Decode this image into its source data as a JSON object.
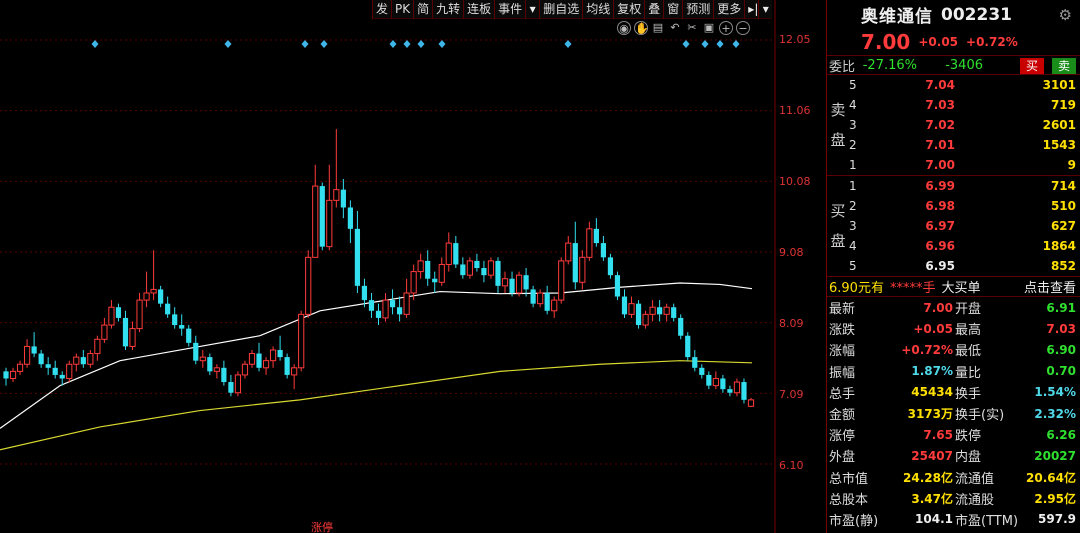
{
  "toolbar": {
    "items": [
      "发",
      "PK",
      "简",
      "九转",
      "连板",
      "事件",
      "▾",
      "删自选",
      "均线",
      "复权",
      "叠",
      "窗",
      "预测",
      "更多",
      "▸|",
      "▾"
    ]
  },
  "chart_icons": [
    "eye-icon",
    "hand-icon",
    "text-icon",
    "undo-icon",
    "scissors-icon",
    "lock-icon",
    "zoom-in-icon",
    "zoom-out-icon"
  ],
  "price_axis": [
    "12.05",
    "11.06",
    "10.08",
    "9.08",
    "8.09",
    "7.09",
    "6.10"
  ],
  "chart_data": {
    "type": "candlestick",
    "title": "",
    "ylim": [
      6.1,
      12.05
    ],
    "colors": {
      "up": "#ff3b3b",
      "down": "#33e0f0",
      "ma_long": "#ffffff",
      "ma_longer": "#d8d830"
    },
    "candles": [
      [
        7.4,
        7.45,
        7.2,
        7.3
      ],
      [
        7.3,
        7.45,
        7.25,
        7.4
      ],
      [
        7.4,
        7.55,
        7.35,
        7.5
      ],
      [
        7.5,
        7.85,
        7.45,
        7.75
      ],
      [
        7.75,
        7.95,
        7.6,
        7.65
      ],
      [
        7.65,
        7.7,
        7.45,
        7.5
      ],
      [
        7.5,
        7.6,
        7.35,
        7.45
      ],
      [
        7.45,
        7.55,
        7.3,
        7.35
      ],
      [
        7.35,
        7.4,
        7.2,
        7.3
      ],
      [
        7.3,
        7.55,
        7.25,
        7.5
      ],
      [
        7.5,
        7.65,
        7.4,
        7.6
      ],
      [
        7.6,
        7.7,
        7.45,
        7.5
      ],
      [
        7.5,
        7.7,
        7.45,
        7.65
      ],
      [
        7.65,
        7.9,
        7.55,
        7.85
      ],
      [
        7.85,
        8.15,
        7.8,
        8.05
      ],
      [
        8.05,
        8.4,
        8.0,
        8.3
      ],
      [
        8.3,
        8.35,
        8.1,
        8.15
      ],
      [
        8.15,
        8.25,
        7.7,
        7.75
      ],
      [
        7.75,
        8.1,
        7.7,
        8.0
      ],
      [
        8.0,
        8.5,
        7.95,
        8.4
      ],
      [
        8.4,
        8.8,
        8.3,
        8.5
      ],
      [
        8.5,
        9.1,
        8.4,
        8.55
      ],
      [
        8.55,
        8.6,
        8.3,
        8.35
      ],
      [
        8.35,
        8.45,
        8.15,
        8.2
      ],
      [
        8.2,
        8.3,
        8.0,
        8.05
      ],
      [
        8.05,
        8.2,
        7.9,
        8.0
      ],
      [
        8.0,
        8.05,
        7.75,
        7.8
      ],
      [
        7.8,
        7.9,
        7.5,
        7.55
      ],
      [
        7.55,
        7.7,
        7.45,
        7.6
      ],
      [
        7.6,
        7.65,
        7.35,
        7.4
      ],
      [
        7.4,
        7.5,
        7.3,
        7.45
      ],
      [
        7.45,
        7.55,
        7.2,
        7.25
      ],
      [
        7.25,
        7.35,
        7.05,
        7.1
      ],
      [
        7.1,
        7.4,
        7.05,
        7.35
      ],
      [
        7.35,
        7.55,
        7.3,
        7.5
      ],
      [
        7.5,
        7.7,
        7.45,
        7.65
      ],
      [
        7.65,
        7.8,
        7.4,
        7.45
      ],
      [
        7.45,
        7.6,
        7.35,
        7.55
      ],
      [
        7.55,
        7.75,
        7.45,
        7.7
      ],
      [
        7.7,
        7.9,
        7.55,
        7.6
      ],
      [
        7.6,
        7.65,
        7.3,
        7.35
      ],
      [
        7.35,
        7.5,
        7.15,
        7.45
      ],
      [
        7.45,
        8.25,
        7.4,
        8.2
      ],
      [
        8.2,
        9.1,
        8.15,
        9.0
      ],
      [
        9.0,
        10.3,
        9.0,
        10.0
      ],
      [
        10.0,
        10.05,
        9.1,
        9.15
      ],
      [
        9.15,
        10.3,
        9.1,
        9.8
      ],
      [
        9.8,
        10.8,
        9.7,
        9.95
      ],
      [
        9.95,
        10.1,
        9.55,
        9.7
      ],
      [
        9.7,
        9.8,
        9.2,
        9.4
      ],
      [
        9.4,
        9.65,
        8.5,
        8.6
      ],
      [
        8.6,
        8.7,
        8.3,
        8.4
      ],
      [
        8.4,
        8.5,
        8.15,
        8.25
      ],
      [
        8.25,
        8.35,
        8.05,
        8.15
      ],
      [
        8.15,
        8.5,
        8.1,
        8.4
      ],
      [
        8.4,
        8.55,
        8.2,
        8.3
      ],
      [
        8.3,
        8.45,
        8.1,
        8.2
      ],
      [
        8.2,
        8.7,
        8.15,
        8.5
      ],
      [
        8.5,
        8.9,
        8.4,
        8.8
      ],
      [
        8.8,
        9.05,
        8.7,
        8.95
      ],
      [
        8.95,
        9.1,
        8.6,
        8.7
      ],
      [
        8.7,
        8.8,
        8.5,
        8.65
      ],
      [
        8.65,
        9.0,
        8.6,
        8.9
      ],
      [
        8.9,
        9.35,
        8.8,
        9.2
      ],
      [
        9.2,
        9.3,
        8.85,
        8.9
      ],
      [
        8.9,
        9.0,
        8.7,
        8.75
      ],
      [
        8.75,
        9.0,
        8.7,
        8.95
      ],
      [
        8.95,
        9.05,
        8.8,
        8.85
      ],
      [
        8.85,
        8.95,
        8.65,
        8.75
      ],
      [
        8.75,
        9.0,
        8.7,
        8.95
      ],
      [
        8.95,
        9.0,
        8.5,
        8.6
      ],
      [
        8.6,
        8.8,
        8.5,
        8.7
      ],
      [
        8.7,
        8.8,
        8.45,
        8.5
      ],
      [
        8.5,
        8.8,
        8.45,
        8.75
      ],
      [
        8.75,
        8.85,
        8.45,
        8.55
      ],
      [
        8.55,
        8.6,
        8.3,
        8.35
      ],
      [
        8.35,
        8.55,
        8.3,
        8.5
      ],
      [
        8.5,
        8.6,
        8.2,
        8.25
      ],
      [
        8.25,
        8.45,
        8.15,
        8.4
      ],
      [
        8.4,
        9.0,
        8.35,
        8.95
      ],
      [
        8.95,
        9.3,
        8.9,
        9.2
      ],
      [
        9.2,
        9.5,
        8.55,
        8.65
      ],
      [
        8.65,
        9.1,
        8.55,
        9.0
      ],
      [
        9.0,
        9.5,
        8.95,
        9.4
      ],
      [
        9.4,
        9.55,
        9.15,
        9.2
      ],
      [
        9.2,
        9.3,
        8.95,
        9.0
      ],
      [
        9.0,
        9.05,
        8.7,
        8.75
      ],
      [
        8.75,
        8.8,
        8.4,
        8.45
      ],
      [
        8.45,
        8.55,
        8.15,
        8.2
      ],
      [
        8.2,
        8.45,
        8.15,
        8.35
      ],
      [
        8.35,
        8.4,
        8.0,
        8.05
      ],
      [
        8.05,
        8.25,
        8.0,
        8.2
      ],
      [
        8.2,
        8.4,
        8.1,
        8.3
      ],
      [
        8.3,
        8.4,
        8.1,
        8.2
      ],
      [
        8.2,
        8.35,
        8.1,
        8.3
      ],
      [
        8.3,
        8.35,
        8.1,
        8.15
      ],
      [
        8.15,
        8.2,
        7.85,
        7.9
      ],
      [
        7.9,
        7.95,
        7.55,
        7.6
      ],
      [
        7.6,
        7.7,
        7.4,
        7.45
      ],
      [
        7.45,
        7.5,
        7.3,
        7.35
      ],
      [
        7.35,
        7.4,
        7.15,
        7.2
      ],
      [
        7.2,
        7.4,
        7.15,
        7.3
      ],
      [
        7.3,
        7.35,
        7.1,
        7.15
      ],
      [
        7.15,
        7.2,
        7.05,
        7.1
      ],
      [
        7.1,
        7.3,
        7.05,
        7.25
      ],
      [
        7.25,
        7.3,
        6.95,
        7.0
      ],
      [
        6.91,
        7.03,
        6.9,
        7.0
      ]
    ],
    "ma_white": [
      [
        0,
        6.6
      ],
      [
        60,
        7.2
      ],
      [
        120,
        7.55
      ],
      [
        200,
        7.75
      ],
      [
        260,
        7.9
      ],
      [
        320,
        8.25
      ],
      [
        400,
        8.43
      ],
      [
        440,
        8.52
      ],
      [
        500,
        8.49
      ],
      [
        560,
        8.5
      ],
      [
        620,
        8.58
      ],
      [
        680,
        8.64
      ],
      [
        720,
        8.62
      ],
      [
        752,
        8.56
      ]
    ],
    "ma_yellow": [
      [
        0,
        6.3
      ],
      [
        100,
        6.62
      ],
      [
        200,
        6.85
      ],
      [
        300,
        7.0
      ],
      [
        400,
        7.2
      ],
      [
        500,
        7.4
      ],
      [
        600,
        7.5
      ],
      [
        680,
        7.55
      ],
      [
        752,
        7.52
      ]
    ],
    "diamonds_x": [
      95,
      228,
      305,
      324,
      393,
      407,
      421,
      442,
      568,
      686,
      705,
      720,
      736
    ]
  },
  "bottom_label": "涨停",
  "stock": {
    "name": "奥维通信",
    "code": "002231",
    "price": "7.00",
    "change": "+0.05",
    "change_pct": "+0.72%"
  },
  "committee": {
    "label": "委比",
    "ratio": "-27.16%",
    "diff": "-3406",
    "buy": "买",
    "sell": "卖"
  },
  "asks_label": [
    "卖",
    "盘"
  ],
  "bids_label": [
    "买",
    "盘"
  ],
  "asks": [
    {
      "lvl": "5",
      "price": "7.04",
      "vol": "3101"
    },
    {
      "lvl": "4",
      "price": "7.03",
      "vol": "719"
    },
    {
      "lvl": "3",
      "price": "7.02",
      "vol": "2601"
    },
    {
      "lvl": "2",
      "price": "7.01",
      "vol": "1543"
    },
    {
      "lvl": "1",
      "price": "7.00",
      "vol": "9"
    }
  ],
  "bids": [
    {
      "lvl": "1",
      "price": "6.99",
      "vol": "714"
    },
    {
      "lvl": "2",
      "price": "6.98",
      "vol": "510"
    },
    {
      "lvl": "3",
      "price": "6.97",
      "vol": "627"
    },
    {
      "lvl": "4",
      "price": "6.96",
      "vol": "1864"
    },
    {
      "lvl": "5",
      "price": "6.95",
      "vol": "852"
    }
  ],
  "ticker": {
    "t1": "6.90元有",
    "t2": "*****手",
    "t3": "大买单",
    "t4": "点击查看"
  },
  "stats": [
    {
      "k": "最新",
      "v": "7.00",
      "vc": "red",
      "k2": "开盘",
      "v2": "6.91",
      "v2c": "green"
    },
    {
      "k": "涨跌",
      "v": "+0.05",
      "vc": "red",
      "k2": "最高",
      "v2": "7.03",
      "v2c": "red"
    },
    {
      "k": "涨幅",
      "v": "+0.72%",
      "vc": "red",
      "k2": "最低",
      "v2": "6.90",
      "v2c": "green"
    },
    {
      "k": "振幅",
      "v": "1.87%",
      "vc": "cyan",
      "k2": "量比",
      "v2": "0.70",
      "v2c": "green"
    },
    {
      "k": "总手",
      "v": "45434",
      "vc": "yellow",
      "k2": "换手",
      "v2": "1.54%",
      "v2c": "cyan"
    },
    {
      "k": "金额",
      "v": "3173万",
      "vc": "yellow",
      "k2": "换手(实)",
      "v2": "2.32%",
      "v2c": "cyan"
    },
    {
      "k": "涨停",
      "v": "7.65",
      "vc": "red",
      "k2": "跌停",
      "v2": "6.26",
      "v2c": "green"
    },
    {
      "k": "外盘",
      "v": "25407",
      "vc": "red",
      "k2": "内盘",
      "v2": "20027",
      "v2c": "green"
    },
    {
      "k": "总市值",
      "v": "24.28亿",
      "vc": "yellow",
      "k2": "流通值",
      "v2": "20.64亿",
      "v2c": "yellow"
    },
    {
      "k": "总股本",
      "v": "3.47亿",
      "vc": "yellow",
      "k2": "流通股",
      "v2": "2.95亿",
      "v2c": "yellow"
    },
    {
      "k": "市盈(静)",
      "v": "104.1",
      "vc": "white",
      "k2": "市盈(TTM)",
      "v2": "597.9",
      "v2c": "white"
    }
  ]
}
